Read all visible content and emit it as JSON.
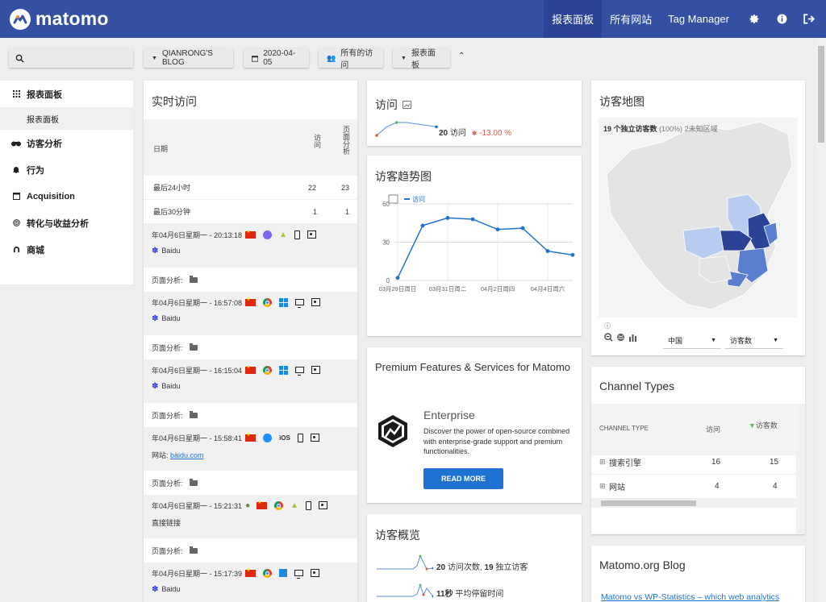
{
  "brand": {
    "name": "matomo"
  },
  "nav": {
    "items": [
      {
        "label": "报表面板",
        "active": true
      },
      {
        "label": "所有网站",
        "active": false
      },
      {
        "label": "Tag Manager",
        "active": false
      }
    ],
    "icons": [
      "gear-icon",
      "info-icon",
      "logout-icon"
    ]
  },
  "controls": {
    "search_placeholder": "",
    "site": "QIANRONG'S BLOG",
    "date": "2020-04-05",
    "segment": "所有的访问",
    "dashboard": "报表面板"
  },
  "sidebar": {
    "items": [
      {
        "label": "报表面板",
        "icon": "grid-icon"
      },
      {
        "label": "访客分析",
        "icon": "visitors-icon"
      },
      {
        "label": "行为",
        "icon": "bell-icon"
      },
      {
        "label": "Acquisition",
        "icon": "acquisition-icon"
      },
      {
        "label": "转化与收益分析",
        "icon": "target-icon"
      },
      {
        "label": "商城",
        "icon": "shop-icon"
      }
    ],
    "sub_item": "报表面板"
  },
  "realtime": {
    "title": "实时访问",
    "col_date": "日期",
    "col_visits": "访问",
    "col_actions": "页面分析",
    "rows": [
      {
        "label": "最后24小时",
        "visits": "22",
        "actions": "23"
      },
      {
        "label": "最后30分钟",
        "visits": "1",
        "actions": "1"
      }
    ],
    "pages_label": "页面分析:",
    "visits": [
      {
        "time": "年04月6日星期一 - 20:13:18",
        "source": "Baidu",
        "source_type": "search",
        "browser": "firefox",
        "os": "android",
        "device": "phone"
      },
      {
        "time": "年04月6日星期一 - 16:57:08",
        "source": "Baidu",
        "source_type": "search",
        "browser": "chrome",
        "os": "windows",
        "device": "desktop"
      },
      {
        "time": "年04月6日星期一 - 16:15:04",
        "source": "Baidu",
        "source_type": "search",
        "browser": "chrome",
        "os": "windows",
        "device": "desktop"
      },
      {
        "time": "年04月6日星期一 - 15:58:41",
        "source_prefix": "网站:",
        "source": "baidu.com",
        "source_type": "website",
        "browser": "safari",
        "os": "iOS",
        "device": "phone"
      },
      {
        "time": "年04月6日星期一 - 15:21:31",
        "source": "直接链接",
        "source_type": "direct",
        "browser": "chrome",
        "os": "android",
        "device": "phone"
      },
      {
        "time": "年04月6日星期一 - 15:17:39",
        "source": "Baidu",
        "source_type": "search",
        "browser": "chrome",
        "os": "windows",
        "device": "desktop"
      }
    ]
  },
  "visits_spark": {
    "title": "访问",
    "value": "20",
    "unit": "访问",
    "change": "-13.00 %",
    "spark": [
      3,
      9,
      12,
      12,
      11,
      10,
      9
    ],
    "colors": {
      "down": "#e05a49",
      "up": "#5cb85c",
      "line": "#1e73d2"
    }
  },
  "trend": {
    "title": "访客趋势图",
    "chart_data": {
      "type": "line",
      "x": [
        "03月29日周日",
        "03月30日周一",
        "03月31日周二",
        "04月1日周三",
        "04月2日周四",
        "04月3日周五",
        "04月4日周六",
        "04月5日周日"
      ],
      "series": [
        {
          "name": "访问",
          "values": [
            2,
            43,
            49,
            48,
            40,
            41,
            23,
            20
          ]
        }
      ],
      "xticks": [
        "03月29日周日",
        "03月31日周二",
        "04月2日周四",
        "04月4日周六"
      ],
      "ylim": [
        0,
        60
      ],
      "yticks": [
        0,
        30,
        60
      ],
      "grid": true,
      "legend": "top-left",
      "color": "#1e73d2"
    }
  },
  "premium": {
    "title": "Premium Features & Services for Matomo",
    "product": "Enterprise",
    "desc": "Discover the power of open-source combined with enterprise-grade support and premium functionalities.",
    "button": "READ MORE"
  },
  "overview": {
    "title": "访客概览",
    "lines": [
      {
        "strong": "20",
        "text": " 访问次数, ",
        "strong2": "19",
        "text2": " 独立访客"
      },
      {
        "strong": "11秒",
        "text": " 平均停留时间"
      }
    ]
  },
  "map": {
    "title": "访客地图",
    "stat_strong": "19 个独立访客数",
    "stat_pct": "(100%)",
    "stat_unknown": "2未知区域",
    "region_select": "中国",
    "metric_select": "访客数",
    "colors": {
      "dark": "#2b4396",
      "mid": "#5b7fcf",
      "light": "#b8cbf0",
      "none": "#e4e4e4"
    }
  },
  "channels": {
    "title": "Channel Types",
    "col_type": "CHANNEL TYPE",
    "col_visits": "访问",
    "col_visitors": "访客数",
    "rows": [
      {
        "label": "搜索引擎",
        "visits": "16",
        "visitors": "15"
      },
      {
        "label": "网站",
        "visits": "4",
        "visitors": "4"
      }
    ]
  },
  "blog": {
    "title": "Matomo.org Blog",
    "link": "Matomo vs WP-Statistics – which web analytics"
  }
}
